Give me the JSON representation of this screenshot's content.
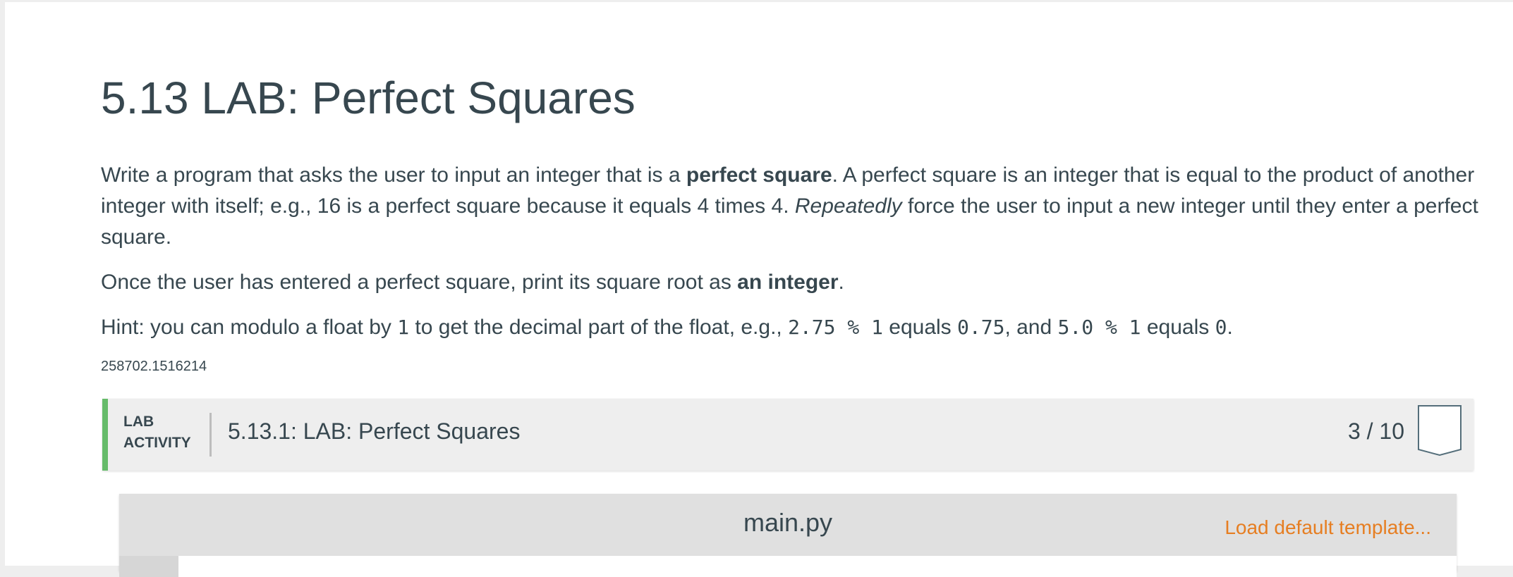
{
  "page": {
    "title": "5.13 LAB: Perfect Squares",
    "paragraph1": {
      "t1": "Write a program that asks the user to input an integer that is a ",
      "b1": "perfect square",
      "t2": ". A perfect square is an integer that is equal to the product of another integer with itself; e.g., 16 is a perfect square because it equals 4 times 4. ",
      "i1": "Repeatedly",
      "t3": " force the user to input a new integer until they enter a perfect square."
    },
    "paragraph2": {
      "t1": "Once the user has entered a perfect square, print its square root as ",
      "b1": "an integer",
      "t2": "."
    },
    "paragraph3": {
      "t1": "Hint: you can modulo a float by ",
      "c1": "1",
      "t2": " to get the decimal part of the float, e.g., ",
      "c2": "2.75 % 1",
      "t3": " equals ",
      "c3": "0.75",
      "t4": ", and ",
      "c4": "5.0 % 1",
      "t5": " equals ",
      "c5": "0",
      "t6": "."
    },
    "resource_id": "258702.1516214"
  },
  "activity": {
    "label_line1": "LAB",
    "label_line2": "ACTIVITY",
    "title": "5.13.1: LAB: Perfect Squares",
    "progress": "3 / 10",
    "accent_color": "#66bb6a",
    "badge_icon": "shield-badge-icon"
  },
  "editor": {
    "filename": "main.py",
    "load_template": "Load default template...",
    "link_color": "#e67e22"
  }
}
